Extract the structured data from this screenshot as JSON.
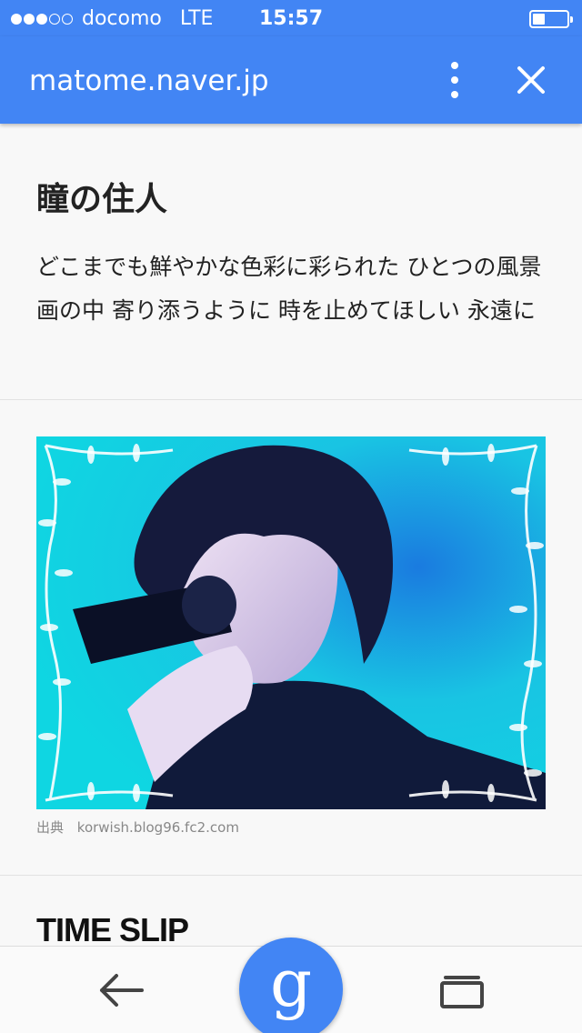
{
  "status_bar": {
    "carrier": "docomo",
    "network": "LTE",
    "time": "15:57",
    "signal_bars_filled": 3,
    "signal_bars_total": 5,
    "battery_level": 0.35
  },
  "app_bar": {
    "url": "matome.naver.jp",
    "menu_icon": "more-vert-icon",
    "close_icon": "close-icon"
  },
  "article": {
    "title": "瞳の住人",
    "body": "どこまでも鮮やかな色彩に彩られた ひとつの風景画の中 寄り添うように 時を止めてほしい 永遠に"
  },
  "image_card": {
    "source_label": "出典",
    "source_url": "korwish.blog96.fc2.com"
  },
  "next_card": {
    "title": "TIME SLIP"
  },
  "bottom_bar": {
    "back_icon": "arrow-left-icon",
    "google_label": "g",
    "tabs_icon": "tabs-icon"
  },
  "colors": {
    "accent": "#4285f4",
    "background": "#f8f8f8"
  }
}
